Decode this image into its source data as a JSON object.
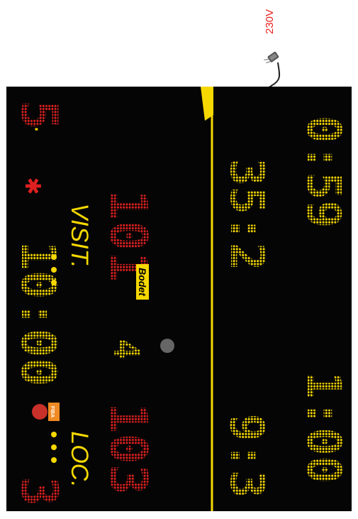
{
  "power": {
    "voltage_label": "230V"
  },
  "scoreboard": {
    "brand": "Bodet",
    "logo_text": "FIBA",
    "colors": {
      "yellow": "#f6d800",
      "red": "#e02020",
      "board": "#050505",
      "wire": "#222222"
    },
    "top_row": {
      "left_red_digit": "3",
      "game_clock": "10:00",
      "right_red_digit": "5"
    },
    "teams": {
      "home_label": "LOC.",
      "away_label": "VISIT.",
      "home_score": "103",
      "away_score": "101",
      "period": "4",
      "home_fouls_dots": 3,
      "away_fouls_dots": 3
    },
    "player_row1": {
      "left": "9:3",
      "right": "35:2"
    },
    "player_row2": {
      "left": "1:00",
      "right": "0:59"
    }
  }
}
